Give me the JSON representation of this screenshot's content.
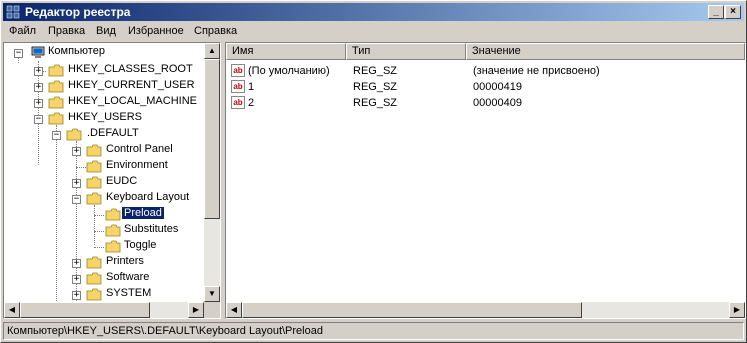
{
  "window": {
    "title": "Редактор реестра",
    "min": "_",
    "max": "□",
    "close": "×"
  },
  "menu": [
    "Файл",
    "Правка",
    "Вид",
    "Избранное",
    "Справка"
  ],
  "tree": {
    "root": "Компьютер",
    "hkcr": "HKEY_CLASSES_ROOT",
    "hkcu": "HKEY_CURRENT_USER",
    "hklm": "HKEY_LOCAL_MACHINE",
    "hku": "HKEY_USERS",
    "default": ".DEFAULT",
    "control_panel": "Control Panel",
    "environment": "Environment",
    "eudc": "EUDC",
    "keyboard_layout": "Keyboard Layout",
    "preload": "Preload",
    "substitutes": "Substitutes",
    "toggle": "Toggle",
    "printers": "Printers",
    "software": "Software",
    "system": "SYSTEM"
  },
  "list": {
    "col_name": "Имя",
    "col_type": "Тип",
    "col_value": "Значение",
    "rows": [
      {
        "name": "(По умолчанию)",
        "type": "REG_SZ",
        "value": "(значение не присвоено)"
      },
      {
        "name": "1",
        "type": "REG_SZ",
        "value": "00000419"
      },
      {
        "name": "2",
        "type": "REG_SZ",
        "value": "00000409"
      }
    ]
  },
  "status": "Компьютер\\HKEY_USERS\\.DEFAULT\\Keyboard Layout\\Preload"
}
